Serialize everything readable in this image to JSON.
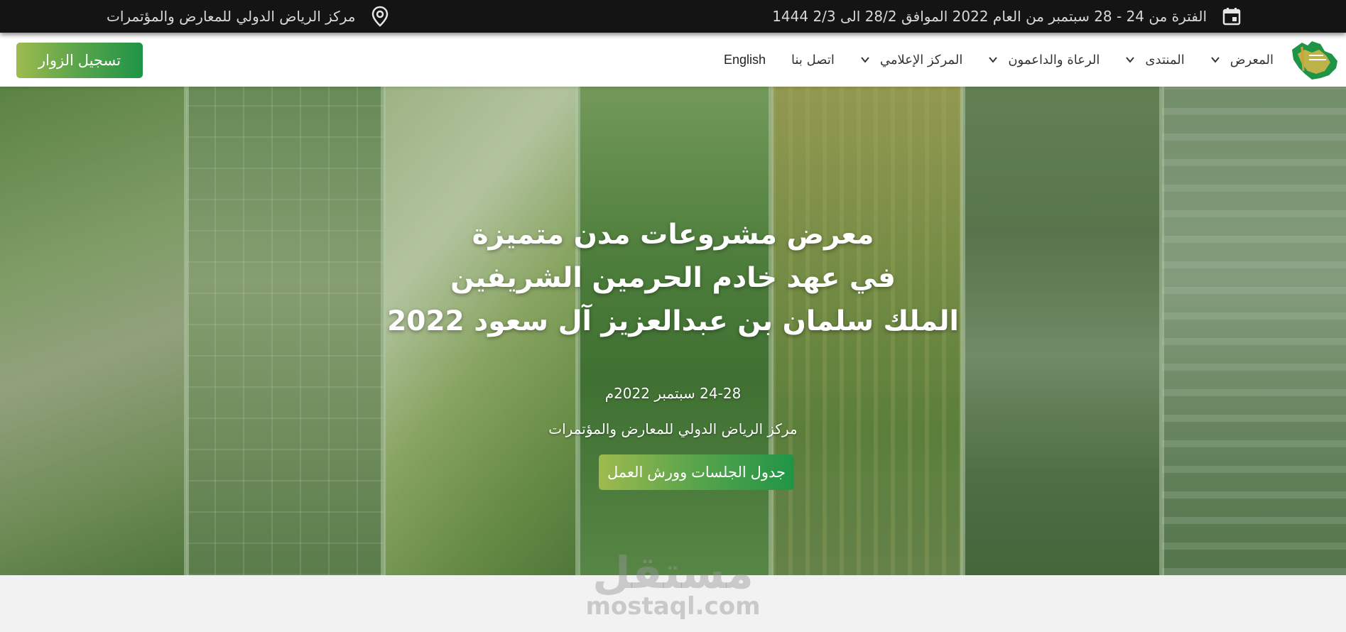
{
  "topbar": {
    "date_text": "الفترة من 24 - 28 سبتمبر من العام 2022 الموافق 28/2 الى 2/3 1444",
    "date_icon": "calendar-icon",
    "location_text": "مركز الرياض الدولي للمعارض والمؤتمرات",
    "location_icon": "map-pin-icon"
  },
  "nav": {
    "logo": "saudi-map-logo",
    "items": [
      {
        "label": "المعرض",
        "has_dropdown": true
      },
      {
        "label": "المنتدى",
        "has_dropdown": true
      },
      {
        "label": "الرعاة والداعمون",
        "has_dropdown": true
      },
      {
        "label": "المركز الإعلامي",
        "has_dropdown": true
      },
      {
        "label": "اتصل بنا",
        "has_dropdown": false
      }
    ],
    "language_link": "English",
    "register_button": "تسجيل الزوار"
  },
  "hero": {
    "title_lines": [
      "معرض مشروعات مدن متميزة",
      "في عهد خادم الحرمين الشريفين",
      "الملك سلمان بن عبدالعزيز آل سعود 2022"
    ],
    "date": "24-28 سبتمبر 2022م",
    "venue": "مركز الرياض الدولي للمعارض والمؤتمرات",
    "schedule_button": "جدول الجلسات وورش العمل"
  },
  "watermark": {
    "arabic": "مستقل",
    "latin": "mostaql.com"
  },
  "colors": {
    "topbar_bg": "#141414",
    "accent_green": "#1f9447",
    "accent_olive": "#9fba4e",
    "nav_bg": "#ffffff"
  }
}
